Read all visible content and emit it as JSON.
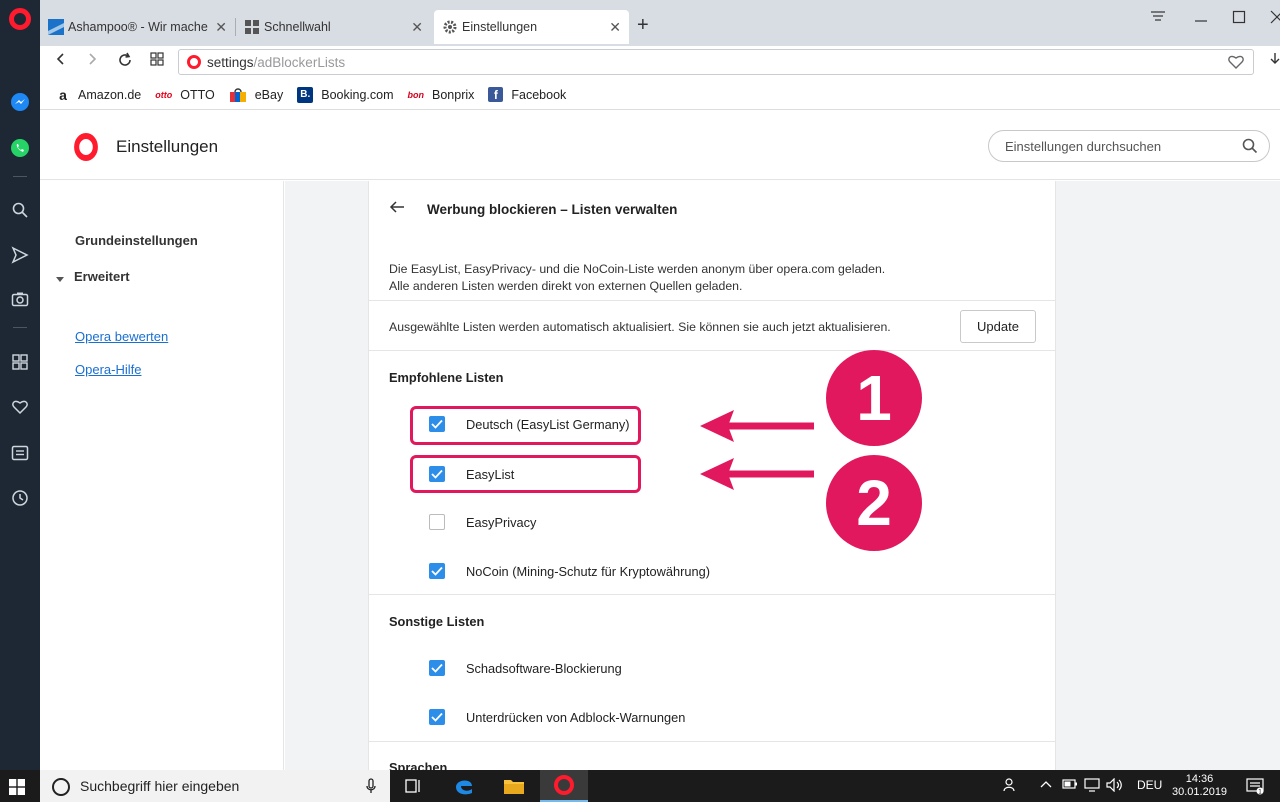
{
  "browser": {
    "tabs": [
      {
        "title": "Ashampoo® - Wir machen",
        "close": "✕"
      },
      {
        "title": "Schnellwahl",
        "close": "✕"
      },
      {
        "title": "Einstellungen",
        "close": "✕"
      }
    ],
    "new_tab": "+",
    "url": {
      "host": "settings",
      "path": "/adBlockerLists"
    },
    "bookmarks": [
      {
        "label": "Amazon.de",
        "icon": "a"
      },
      {
        "label": "OTTO",
        "icon": "otto"
      },
      {
        "label": "eBay",
        "icon": "shop"
      },
      {
        "label": "Booking.com",
        "icon": "B."
      },
      {
        "label": "Bonprix",
        "icon": "bon"
      },
      {
        "label": "Facebook",
        "icon": "f"
      }
    ]
  },
  "settings": {
    "title": "Einstellungen",
    "search_placeholder": "Einstellungen durchsuchen",
    "nav": {
      "basic": "Grundeinstellungen",
      "advanced": "Erweitert",
      "rate": "Opera bewerten",
      "help": "Opera-Hilfe"
    }
  },
  "page": {
    "title": "Werbung blockieren – Listen verwalten",
    "desc_line1": "Die EasyList, EasyPrivacy- und die NoCoin-Liste werden anonym über opera.com geladen.",
    "desc_line2": "Alle anderen Listen werden direkt von externen Quellen geladen.",
    "update_text": "Ausgewählte Listen werden automatisch aktualisiert. Sie können sie auch jetzt aktualisieren.",
    "update_button": "Update",
    "recommended": {
      "title": "Empfohlene Listen",
      "items": [
        {
          "label": "Deutsch (EasyList Germany)",
          "checked": true
        },
        {
          "label": "EasyList",
          "checked": true
        },
        {
          "label": "EasyPrivacy",
          "checked": false
        },
        {
          "label": "NoCoin (Mining-Schutz für Kryptowährung)",
          "checked": true
        }
      ]
    },
    "other": {
      "title": "Sonstige Listen",
      "items": [
        {
          "label": "Schadsoftware-Blockierung",
          "checked": true
        },
        {
          "label": "Unterdrücken von Adblock-Warnungen",
          "checked": true
        }
      ]
    },
    "languages_title": "Sprachen"
  },
  "annotations": {
    "one": "1",
    "two": "2",
    "color": "#e1185d"
  },
  "taskbar": {
    "search_placeholder": "Suchbegriff hier eingeben",
    "lang": "DEU",
    "time": "14:36",
    "date": "30.01.2019"
  },
  "colors": {
    "opera_red": "#ff1b2d",
    "checkbox_blue": "#2c8ee8",
    "link_blue": "#1a6fd2"
  }
}
